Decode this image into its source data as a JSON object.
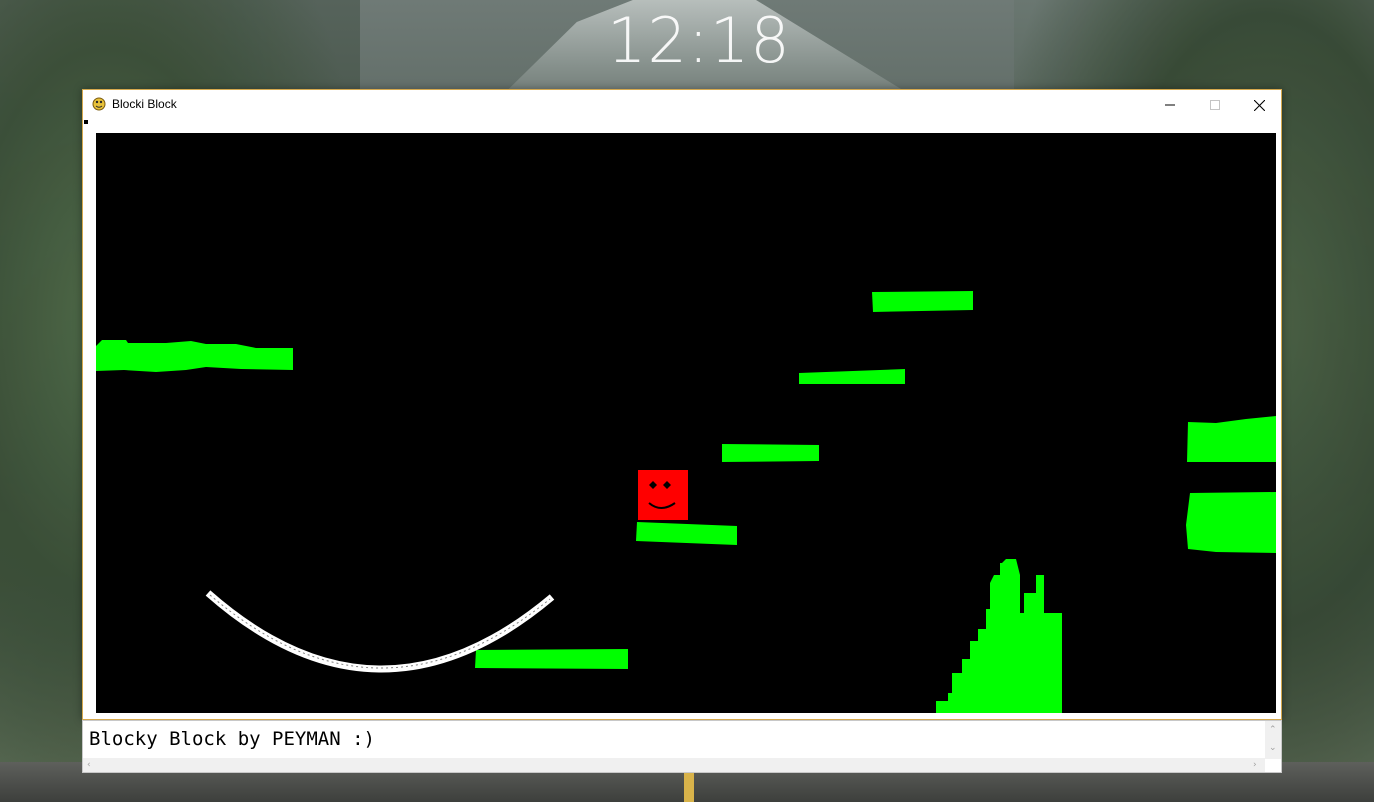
{
  "desktop": {
    "clock": "12:18"
  },
  "window": {
    "title": "Blocki Block",
    "icon": "pygame-snake-icon",
    "controls": {
      "minimize_icon": "minimize-icon",
      "maximize_icon": "maximize-icon",
      "close_icon": "close-icon"
    }
  },
  "game": {
    "background_color": "#000000",
    "platform_color": "#00ff00",
    "player_color": "#ff0000",
    "arc_color": "#ffffff"
  },
  "console": {
    "text": "Blocky Block by PEYMAN :)"
  }
}
